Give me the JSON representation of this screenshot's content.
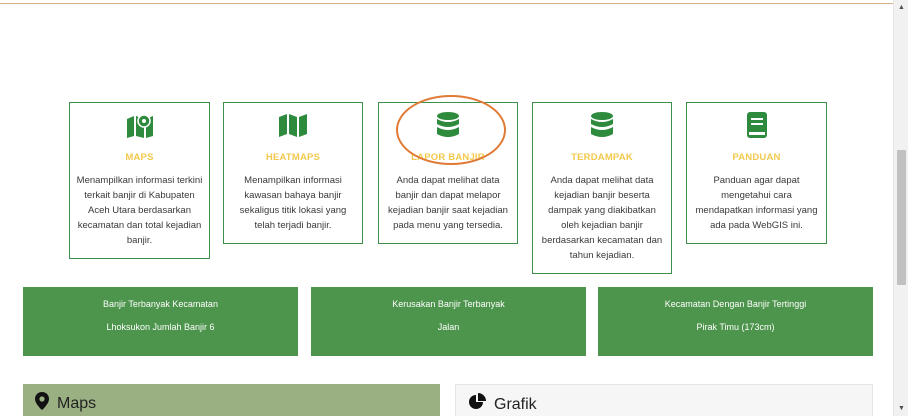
{
  "cards": [
    {
      "icon": "map-marker-icon",
      "title": "MAPS",
      "desc": "Menampilkan informasi terkini terkait banjir di Kabupaten Aceh Utara berdasarkan kecamatan dan total kejadian banjir."
    },
    {
      "icon": "map-icon",
      "title": "HEATMAPS",
      "desc": "Menampilkan informasi kawasan bahaya banjir sekaligus titik lokasi yang telah terjadi banjir."
    },
    {
      "icon": "database-icon",
      "title": "LAPOR BANJIR",
      "desc": "Anda dapat melihat data banjir dan dapat melapor kejadian banjir saat kejadian pada menu yang tersedia."
    },
    {
      "icon": "database-icon",
      "title": "TERDAMPAK",
      "desc": "Anda dapat melihat data kejadian banjir beserta dampak yang diakibatkan oleh kejadian banjir berdasarkan kecamatan dan tahun kejadian."
    },
    {
      "icon": "book-icon",
      "title": "PANDUAN",
      "desc": "Panduan agar dapat mengetahui cara mendapatkan informasi yang ada pada WebGIS ini."
    }
  ],
  "stats": [
    {
      "label": "Banjir Terbanyak Kecamatan",
      "value": "Lhoksukon Jumlah Banjir 6"
    },
    {
      "label": "Kerusakan Banjir Terbanyak",
      "value": "Jalan"
    },
    {
      "label": "Kecamatan Dengan Banjir Tertinggi",
      "value": "Pirak Timu (173cm)"
    }
  ],
  "panels": {
    "maps_title": "Maps",
    "grafik_title": "Grafik"
  },
  "scrollbar": {
    "up_glyph": "▲",
    "down_glyph": "▼"
  },
  "colors": {
    "card_border": "#3e8f4a",
    "icon_green": "#2e8b3e",
    "title_yellow": "#f2c94c",
    "stat_bg": "#4d944c",
    "maps_panel_bg": "#9aaf82",
    "annotation_orange": "#e07a35"
  }
}
